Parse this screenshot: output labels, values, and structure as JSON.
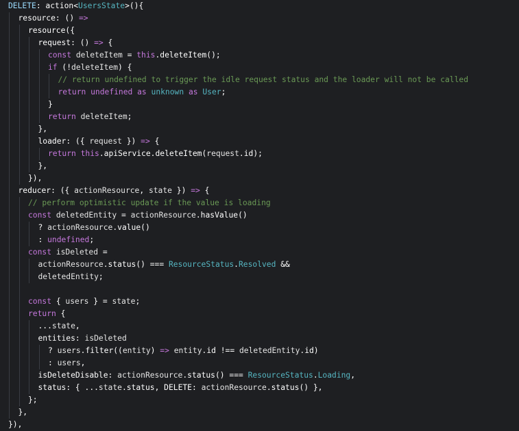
{
  "editor": {
    "background": "#1e1f22",
    "guide_color": "#3a3d44",
    "colors": {
      "plain": "#ffffff",
      "property": "#ffffff",
      "keyword": "#c678dd",
      "function": "#61afef",
      "type": "#56b6c2",
      "comment": "#6a9955",
      "operator": "#c678dd",
      "variable": "#e5e5e5"
    },
    "lines": [
      {
        "indent": 0,
        "tokens": [
          {
            "t": "DELETE",
            "c": "#9cdcfe"
          },
          {
            "t": ": ",
            "c": "#ffffff"
          },
          {
            "t": "action",
            "c": "#ffffff"
          },
          {
            "t": "<",
            "c": "#ffffff"
          },
          {
            "t": "UsersState",
            "c": "#56b6c2"
          },
          {
            "t": ">",
            "c": "#ffffff"
          },
          {
            "t": "(){",
            "c": "#ffffff"
          }
        ]
      },
      {
        "indent": 1,
        "tokens": [
          {
            "t": "resource",
            "c": "#ffffff"
          },
          {
            "t": ": () ",
            "c": "#ffffff"
          },
          {
            "t": "=>",
            "c": "#c678dd"
          }
        ]
      },
      {
        "indent": 2,
        "tokens": [
          {
            "t": "resource",
            "c": "#ffffff"
          },
          {
            "t": "({",
            "c": "#ffffff"
          }
        ]
      },
      {
        "indent": 3,
        "tokens": [
          {
            "t": "request",
            "c": "#ffffff"
          },
          {
            "t": ": () ",
            "c": "#ffffff"
          },
          {
            "t": "=>",
            "c": "#c678dd"
          },
          {
            "t": " {",
            "c": "#ffffff"
          }
        ]
      },
      {
        "indent": 4,
        "tokens": [
          {
            "t": "const ",
            "c": "#c678dd"
          },
          {
            "t": "deleteItem",
            "c": "#e5e5e5"
          },
          {
            "t": " = ",
            "c": "#ffffff"
          },
          {
            "t": "this",
            "c": "#c678dd"
          },
          {
            "t": ".",
            "c": "#ffffff"
          },
          {
            "t": "deleteItem",
            "c": "#ffffff"
          },
          {
            "t": "();",
            "c": "#ffffff"
          }
        ]
      },
      {
        "indent": 4,
        "tokens": [
          {
            "t": "if ",
            "c": "#c678dd"
          },
          {
            "t": "(!",
            "c": "#ffffff"
          },
          {
            "t": "deleteItem",
            "c": "#e5e5e5"
          },
          {
            "t": ") {",
            "c": "#ffffff"
          }
        ]
      },
      {
        "indent": 5,
        "tokens": [
          {
            "t": "// return undefined to trigger the idle request status and the loader will not be called",
            "c": "#6a9955"
          }
        ]
      },
      {
        "indent": 5,
        "tokens": [
          {
            "t": "return ",
            "c": "#c678dd"
          },
          {
            "t": "undefined ",
            "c": "#c678dd"
          },
          {
            "t": "as ",
            "c": "#c678dd"
          },
          {
            "t": "unknown ",
            "c": "#56b6c2"
          },
          {
            "t": "as ",
            "c": "#c678dd"
          },
          {
            "t": "User",
            "c": "#56b6c2"
          },
          {
            "t": ";",
            "c": "#ffffff"
          }
        ]
      },
      {
        "indent": 4,
        "tokens": [
          {
            "t": "}",
            "c": "#ffffff"
          }
        ]
      },
      {
        "indent": 4,
        "tokens": [
          {
            "t": "return ",
            "c": "#c678dd"
          },
          {
            "t": "deleteItem",
            "c": "#e5e5e5"
          },
          {
            "t": ";",
            "c": "#ffffff"
          }
        ]
      },
      {
        "indent": 3,
        "tokens": [
          {
            "t": "},",
            "c": "#ffffff"
          }
        ]
      },
      {
        "indent": 3,
        "tokens": [
          {
            "t": "loader",
            "c": "#ffffff"
          },
          {
            "t": ": ({ ",
            "c": "#ffffff"
          },
          {
            "t": "request",
            "c": "#e5e5e5"
          },
          {
            "t": " }) ",
            "c": "#ffffff"
          },
          {
            "t": "=>",
            "c": "#c678dd"
          },
          {
            "t": " {",
            "c": "#ffffff"
          }
        ]
      },
      {
        "indent": 4,
        "tokens": [
          {
            "t": "return ",
            "c": "#c678dd"
          },
          {
            "t": "this",
            "c": "#c678dd"
          },
          {
            "t": ".",
            "c": "#ffffff"
          },
          {
            "t": "apiService",
            "c": "#ffffff"
          },
          {
            "t": ".",
            "c": "#ffffff"
          },
          {
            "t": "deleteItem",
            "c": "#ffffff"
          },
          {
            "t": "(",
            "c": "#ffffff"
          },
          {
            "t": "request",
            "c": "#e5e5e5"
          },
          {
            "t": ".",
            "c": "#ffffff"
          },
          {
            "t": "id",
            "c": "#ffffff"
          },
          {
            "t": ");",
            "c": "#ffffff"
          }
        ]
      },
      {
        "indent": 3,
        "tokens": [
          {
            "t": "},",
            "c": "#ffffff"
          }
        ]
      },
      {
        "indent": 2,
        "tokens": [
          {
            "t": "}),",
            "c": "#ffffff"
          }
        ]
      },
      {
        "indent": 1,
        "tokens": [
          {
            "t": "reducer",
            "c": "#ffffff"
          },
          {
            "t": ": ({ ",
            "c": "#ffffff"
          },
          {
            "t": "actionResource",
            "c": "#e5e5e5"
          },
          {
            "t": ", ",
            "c": "#ffffff"
          },
          {
            "t": "state",
            "c": "#e5e5e5"
          },
          {
            "t": " }) ",
            "c": "#ffffff"
          },
          {
            "t": "=>",
            "c": "#c678dd"
          },
          {
            "t": " {",
            "c": "#ffffff"
          }
        ]
      },
      {
        "indent": 2,
        "tokens": [
          {
            "t": "// perform optimistic update if the value is loading",
            "c": "#6a9955"
          }
        ]
      },
      {
        "indent": 2,
        "tokens": [
          {
            "t": "const ",
            "c": "#c678dd"
          },
          {
            "t": "deletedEntity",
            "c": "#e5e5e5"
          },
          {
            "t": " = ",
            "c": "#ffffff"
          },
          {
            "t": "actionResource",
            "c": "#e5e5e5"
          },
          {
            "t": ".",
            "c": "#ffffff"
          },
          {
            "t": "hasValue",
            "c": "#ffffff"
          },
          {
            "t": "()",
            "c": "#ffffff"
          }
        ]
      },
      {
        "indent": 3,
        "tokens": [
          {
            "t": "? ",
            "c": "#ffffff"
          },
          {
            "t": "actionResource",
            "c": "#e5e5e5"
          },
          {
            "t": ".",
            "c": "#ffffff"
          },
          {
            "t": "value",
            "c": "#ffffff"
          },
          {
            "t": "()",
            "c": "#ffffff"
          }
        ]
      },
      {
        "indent": 3,
        "tokens": [
          {
            "t": ": ",
            "c": "#ffffff"
          },
          {
            "t": "undefined",
            "c": "#c678dd"
          },
          {
            "t": ";",
            "c": "#ffffff"
          }
        ]
      },
      {
        "indent": 2,
        "tokens": [
          {
            "t": "const ",
            "c": "#c678dd"
          },
          {
            "t": "isDeleted",
            "c": "#e5e5e5"
          },
          {
            "t": " =",
            "c": "#ffffff"
          }
        ]
      },
      {
        "indent": 3,
        "tokens": [
          {
            "t": "actionResource",
            "c": "#e5e5e5"
          },
          {
            "t": ".",
            "c": "#ffffff"
          },
          {
            "t": "status",
            "c": "#ffffff"
          },
          {
            "t": "() === ",
            "c": "#ffffff"
          },
          {
            "t": "ResourceStatus",
            "c": "#56b6c2"
          },
          {
            "t": ".",
            "c": "#ffffff"
          },
          {
            "t": "Resolved",
            "c": "#56b6c2"
          },
          {
            "t": " &&",
            "c": "#ffffff"
          }
        ]
      },
      {
        "indent": 3,
        "tokens": [
          {
            "t": "deletedEntity",
            "c": "#e5e5e5"
          },
          {
            "t": ";",
            "c": "#ffffff"
          }
        ]
      },
      {
        "indent": 2,
        "tokens": []
      },
      {
        "indent": 2,
        "tokens": [
          {
            "t": "const ",
            "c": "#c678dd"
          },
          {
            "t": "{ ",
            "c": "#ffffff"
          },
          {
            "t": "users",
            "c": "#e5e5e5"
          },
          {
            "t": " } = ",
            "c": "#ffffff"
          },
          {
            "t": "state",
            "c": "#e5e5e5"
          },
          {
            "t": ";",
            "c": "#ffffff"
          }
        ]
      },
      {
        "indent": 2,
        "tokens": [
          {
            "t": "return ",
            "c": "#c678dd"
          },
          {
            "t": "{",
            "c": "#ffffff"
          }
        ]
      },
      {
        "indent": 3,
        "tokens": [
          {
            "t": "...",
            "c": "#ffffff"
          },
          {
            "t": "state",
            "c": "#e5e5e5"
          },
          {
            "t": ",",
            "c": "#ffffff"
          }
        ]
      },
      {
        "indent": 3,
        "tokens": [
          {
            "t": "entities",
            "c": "#ffffff"
          },
          {
            "t": ": ",
            "c": "#ffffff"
          },
          {
            "t": "isDeleted",
            "c": "#e5e5e5"
          }
        ]
      },
      {
        "indent": 4,
        "tokens": [
          {
            "t": "? ",
            "c": "#ffffff"
          },
          {
            "t": "users",
            "c": "#e5e5e5"
          },
          {
            "t": ".",
            "c": "#ffffff"
          },
          {
            "t": "filter",
            "c": "#ffffff"
          },
          {
            "t": "((",
            "c": "#ffffff"
          },
          {
            "t": "entity",
            "c": "#e5e5e5"
          },
          {
            "t": ") ",
            "c": "#ffffff"
          },
          {
            "t": "=>",
            "c": "#c678dd"
          },
          {
            "t": " ",
            "c": "#ffffff"
          },
          {
            "t": "entity",
            "c": "#e5e5e5"
          },
          {
            "t": ".",
            "c": "#ffffff"
          },
          {
            "t": "id",
            "c": "#ffffff"
          },
          {
            "t": " !== ",
            "c": "#ffffff"
          },
          {
            "t": "deletedEntity",
            "c": "#e5e5e5"
          },
          {
            "t": ".",
            "c": "#ffffff"
          },
          {
            "t": "id",
            "c": "#ffffff"
          },
          {
            "t": ")",
            "c": "#ffffff"
          }
        ]
      },
      {
        "indent": 4,
        "tokens": [
          {
            "t": ": ",
            "c": "#ffffff"
          },
          {
            "t": "users",
            "c": "#e5e5e5"
          },
          {
            "t": ",",
            "c": "#ffffff"
          }
        ]
      },
      {
        "indent": 3,
        "tokens": [
          {
            "t": "isDeleteDisable",
            "c": "#ffffff"
          },
          {
            "t": ": ",
            "c": "#ffffff"
          },
          {
            "t": "actionResource",
            "c": "#e5e5e5"
          },
          {
            "t": ".",
            "c": "#ffffff"
          },
          {
            "t": "status",
            "c": "#ffffff"
          },
          {
            "t": "() === ",
            "c": "#ffffff"
          },
          {
            "t": "ResourceStatus",
            "c": "#56b6c2"
          },
          {
            "t": ".",
            "c": "#ffffff"
          },
          {
            "t": "Loading",
            "c": "#56b6c2"
          },
          {
            "t": ",",
            "c": "#ffffff"
          }
        ]
      },
      {
        "indent": 3,
        "tokens": [
          {
            "t": "status",
            "c": "#ffffff"
          },
          {
            "t": ": { ...",
            "c": "#ffffff"
          },
          {
            "t": "state",
            "c": "#e5e5e5"
          },
          {
            "t": ".",
            "c": "#ffffff"
          },
          {
            "t": "status",
            "c": "#ffffff"
          },
          {
            "t": ", ",
            "c": "#ffffff"
          },
          {
            "t": "DELETE",
            "c": "#ffffff"
          },
          {
            "t": ": ",
            "c": "#ffffff"
          },
          {
            "t": "actionResource",
            "c": "#e5e5e5"
          },
          {
            "t": ".",
            "c": "#ffffff"
          },
          {
            "t": "status",
            "c": "#ffffff"
          },
          {
            "t": "() },",
            "c": "#ffffff"
          }
        ]
      },
      {
        "indent": 2,
        "tokens": [
          {
            "t": "};",
            "c": "#ffffff"
          }
        ]
      },
      {
        "indent": 1,
        "tokens": [
          {
            "t": "},",
            "c": "#ffffff"
          }
        ]
      },
      {
        "indent": 0,
        "tokens": [
          {
            "t": "}),",
            "c": "#ffffff"
          }
        ]
      }
    ]
  }
}
